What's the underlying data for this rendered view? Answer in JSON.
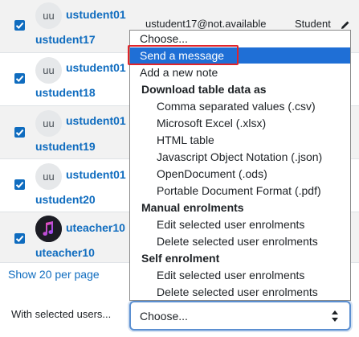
{
  "rows": [
    {
      "first": "ustudent01",
      "second": "ustudent17",
      "initials": "uu",
      "email": "ustudent17@not.available",
      "role": "Student"
    },
    {
      "first": "ustudent01",
      "second": "ustudent18",
      "initials": "uu"
    },
    {
      "first": "ustudent01",
      "second": "ustudent19",
      "initials": "uu"
    },
    {
      "first": "ustudent01",
      "second": "ustudent20",
      "initials": "uu"
    },
    {
      "first": "uteacher10",
      "second": "uteacher10",
      "initials": ""
    }
  ],
  "show_per_page": "Show 20 per page",
  "bulk": {
    "label": "With selected users...",
    "selected": "Choose..."
  },
  "dropdown": {
    "choose": "Choose...",
    "send_message": "Send a message",
    "add_note": "Add a new note",
    "groups": [
      {
        "label": "Download table data as",
        "options": [
          "Comma separated values (.csv)",
          "Microsoft Excel (.xlsx)",
          "HTML table",
          "Javascript Object Notation (.json)",
          "OpenDocument (.ods)",
          "Portable Document Format (.pdf)"
        ]
      },
      {
        "label": "Manual enrolments",
        "options": [
          "Edit selected user enrolments",
          "Delete selected user enrolments"
        ]
      },
      {
        "label": "Self enrolment",
        "options": [
          "Edit selected user enrolments",
          "Delete selected user enrolments"
        ]
      }
    ]
  },
  "colors": {
    "link": "#0f6cbf",
    "highlight": "#1f6fd6",
    "annotation": "#e0242a"
  }
}
